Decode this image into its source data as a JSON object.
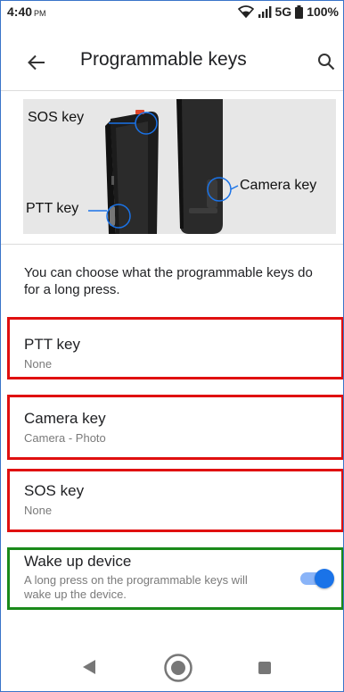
{
  "status": {
    "time": "4:40",
    "ampm": "PM",
    "network": "5G",
    "battery": "100%"
  },
  "appbar": {
    "title": "Programmable keys",
    "back_icon": "arrow-back-icon",
    "search_icon": "search-icon"
  },
  "illustration": {
    "sos_label": "SOS key",
    "ptt_label": "PTT key",
    "camera_label": "Camera key",
    "callout_color": "#1a73e8"
  },
  "description": "You can choose what the programmable keys do for a long press.",
  "items": [
    {
      "title": "PTT key",
      "value": "None"
    },
    {
      "title": "Camera key",
      "value": "Camera - Photo"
    },
    {
      "title": "SOS key",
      "value": "None"
    }
  ],
  "wake": {
    "title": "Wake up device",
    "subtitle": "A long press on the programmable keys will wake up the device.",
    "enabled": true
  },
  "colors": {
    "accent": "#1a73e8",
    "highlight_red": "#e01010",
    "highlight_green": "#1a8a1a"
  }
}
